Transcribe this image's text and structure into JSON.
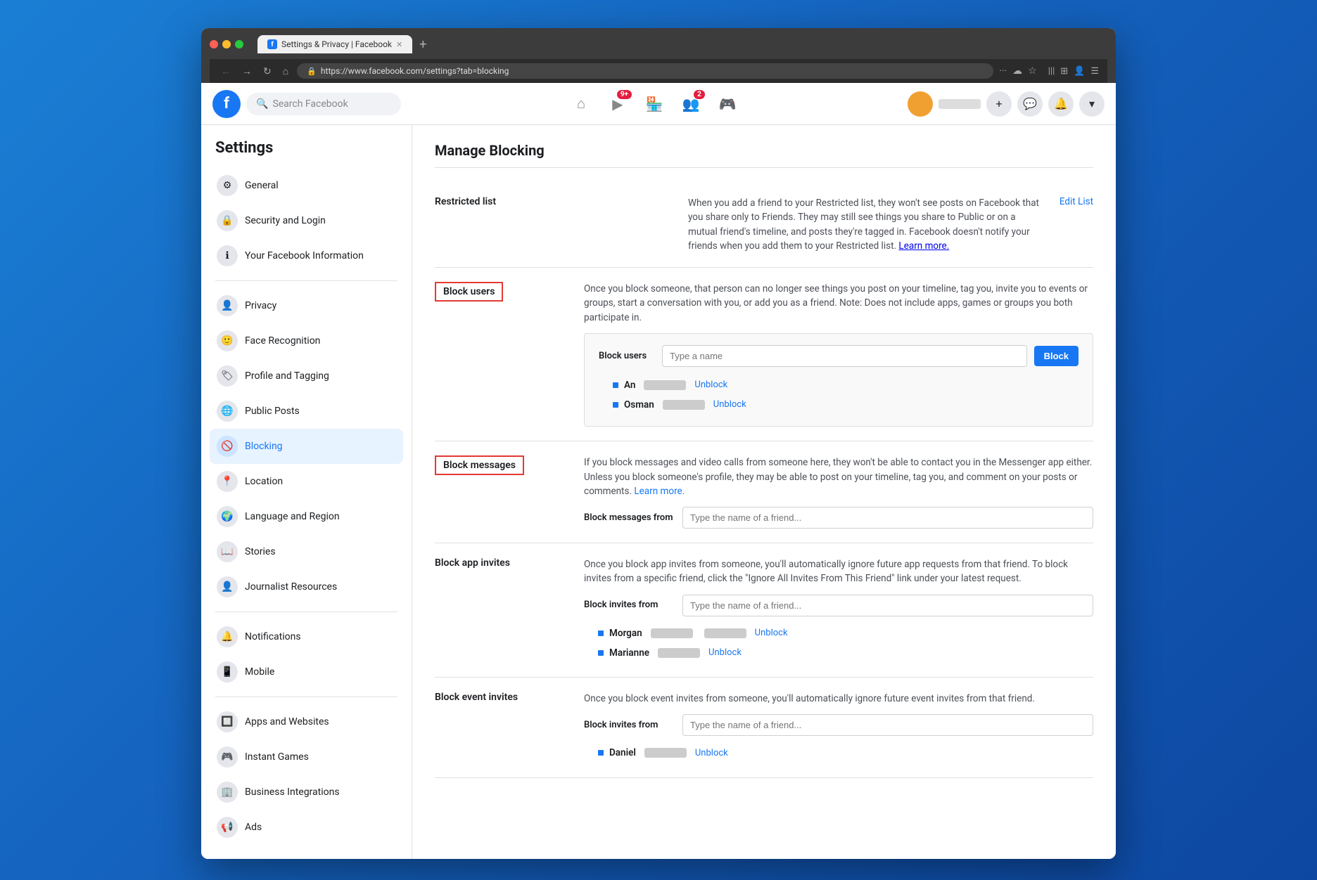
{
  "browser": {
    "tab_title": "Settings & Privacy | Facebook",
    "url": "https://www.facebook.com/settings?tab=blocking",
    "new_tab_icon": "+"
  },
  "navbar": {
    "logo_letter": "f",
    "search_placeholder": "Search Facebook",
    "nav_icons": [
      {
        "name": "home",
        "symbol": "⌂",
        "badge": null
      },
      {
        "name": "watch",
        "symbol": "▶",
        "badge": "9+"
      },
      {
        "name": "marketplace",
        "symbol": "🏪",
        "badge": null
      },
      {
        "name": "groups",
        "symbol": "👥",
        "badge": "2"
      },
      {
        "name": "gaming",
        "symbol": "🎮",
        "badge": null
      }
    ],
    "add_btn": "+",
    "messenger_icon": "💬",
    "notifications_icon": "🔔",
    "dropdown_icon": "▾"
  },
  "sidebar": {
    "title": "Settings",
    "items": [
      {
        "label": "General",
        "icon": "⚙"
      },
      {
        "label": "Security and Login",
        "icon": "🔒"
      },
      {
        "label": "Your Facebook Information",
        "icon": "ℹ"
      },
      {
        "label": "Privacy",
        "icon": "👤"
      },
      {
        "label": "Face Recognition",
        "icon": "🙂"
      },
      {
        "label": "Profile and Tagging",
        "icon": "🏷"
      },
      {
        "label": "Public Posts",
        "icon": "🌐"
      },
      {
        "label": "Blocking",
        "icon": "🚫",
        "active": true
      },
      {
        "label": "Location",
        "icon": "📍"
      },
      {
        "label": "Language and Region",
        "icon": "🌍"
      },
      {
        "label": "Stories",
        "icon": "📖"
      },
      {
        "label": "Journalist Resources",
        "icon": "👤"
      },
      {
        "label": "Notifications",
        "icon": "🔔"
      },
      {
        "label": "Mobile",
        "icon": "📱"
      },
      {
        "label": "Apps and Websites",
        "icon": "🔲"
      },
      {
        "label": "Instant Games",
        "icon": "🎮"
      },
      {
        "label": "Business Integrations",
        "icon": "🏢"
      },
      {
        "label": "Ads",
        "icon": "📢"
      }
    ]
  },
  "main": {
    "title": "Manage Blocking",
    "sections": {
      "restricted_list": {
        "label": "Restricted list",
        "description": "When you add a friend to your Restricted list, they won't see posts on Facebook that you share only to Friends. They may still see things you share to Public or on a mutual friend's timeline, and posts they're tagged in. Facebook doesn't notify your friends when you add them to your Restricted list.",
        "learn_more": "Learn more.",
        "edit_link": "Edit List"
      },
      "block_users": {
        "label": "Block users",
        "description": "Once you block someone, that person can no longer see things you post on your timeline, tag you, invite you to events or groups, start a conversation with you, or add you as a friend. Note: Does not include apps, games or groups you both participate in.",
        "input_label": "Block users",
        "input_placeholder": "Type a name",
        "button_label": "Block",
        "blocked_users": [
          {
            "name": "An",
            "unblock": "Unblock"
          },
          {
            "name": "Osman",
            "unblock": "Unblock"
          }
        ]
      },
      "block_messages": {
        "label": "Block messages",
        "description": "If you block messages and video calls from someone here, they won't be able to contact you in the Messenger app either. Unless you block someone's profile, they may be able to post on your timeline, tag you, and comment on your posts or comments.",
        "learn_more": "Learn more.",
        "input_label": "Block messages from",
        "input_placeholder": "Type the name of a friend..."
      },
      "block_app_invites": {
        "label": "Block app invites",
        "description": "Once you block app invites from someone, you'll automatically ignore future app requests from that friend. To block invites from a specific friend, click the \"Ignore All Invites From This Friend\" link under your latest request.",
        "input_label": "Block invites from",
        "input_placeholder": "Type the name of a friend...",
        "blocked_users": [
          {
            "name": "Morgan",
            "unblock": "Unblock"
          },
          {
            "name": "Marianne",
            "unblock": "Unblock"
          }
        ]
      },
      "block_event_invites": {
        "label": "Block event invites",
        "description": "Once you block event invites from someone, you'll automatically ignore future event invites from that friend.",
        "input_label": "Block invites from",
        "input_placeholder": "Type the name of a friend...",
        "blocked_users": [
          {
            "name": "Daniel",
            "unblock": "Unblock"
          }
        ]
      }
    }
  }
}
